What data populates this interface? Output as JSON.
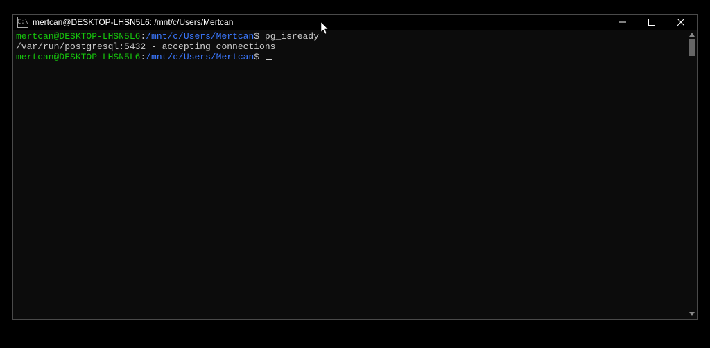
{
  "titlebar": {
    "icon_text": "C:\\",
    "title": "mertcan@DESKTOP-LHSN5L6: /mnt/c/Users/Mertcan"
  },
  "terminal": {
    "lines": [
      {
        "user_host": "mertcan@DESKTOP-LHSN5L6",
        "colon": ":",
        "path": "/mnt/c/Users/Mertcan",
        "dollar": "$ ",
        "command": "pg_isready"
      },
      {
        "output": "/var/run/postgresql:5432 - accepting connections"
      },
      {
        "user_host": "mertcan@DESKTOP-LHSN5L6",
        "colon": ":",
        "path": "/mnt/c/Users/Mertcan",
        "dollar": "$ ",
        "command": ""
      }
    ]
  }
}
